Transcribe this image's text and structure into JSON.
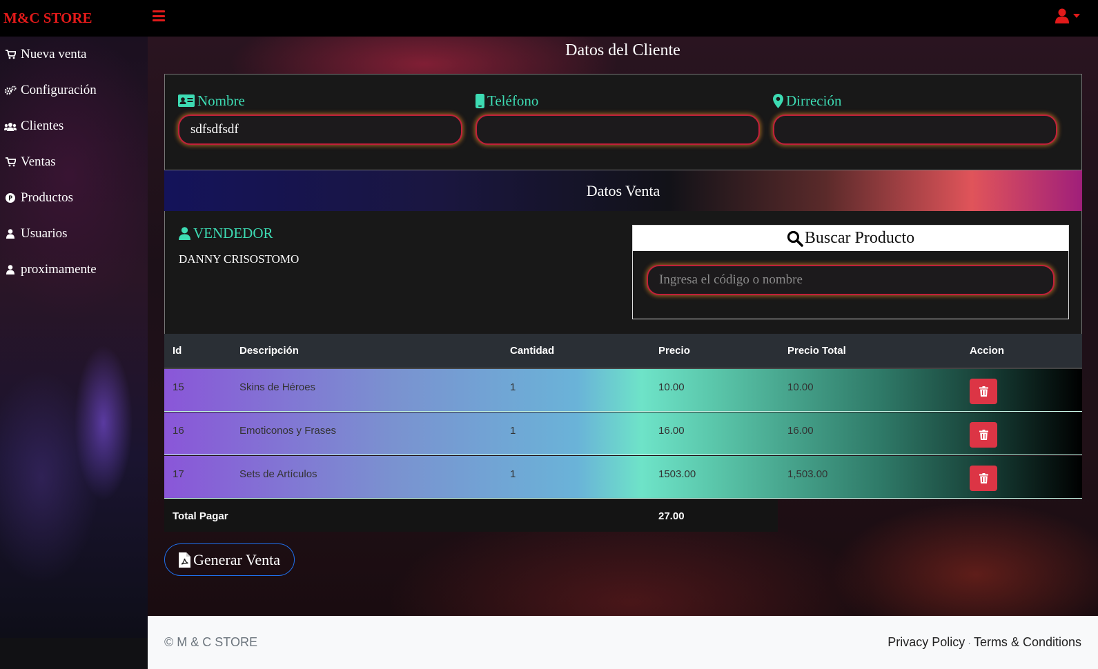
{
  "brand": "M&C STORE",
  "colors": {
    "brand_red": "#e21a1a",
    "accent_teal": "#3ddbb3",
    "danger": "#dc3545",
    "primary_blue": "#1f6feb"
  },
  "sidebar": {
    "items": [
      {
        "label": "Nueva venta",
        "icon": "cart-icon"
      },
      {
        "label": "Configuración",
        "icon": "gears-icon"
      },
      {
        "label": "Clientes",
        "icon": "users-icon"
      },
      {
        "label": "Ventas",
        "icon": "cart-icon"
      },
      {
        "label": "Productos",
        "icon": "product-p-icon"
      },
      {
        "label": "Usuarios",
        "icon": "user-icon"
      },
      {
        "label": "proximamente",
        "icon": "user-icon"
      }
    ]
  },
  "client": {
    "title": "Datos del Cliente",
    "nombre_label": "Nombre",
    "nombre_value": "sdfsdfsdf",
    "telefono_label": "Teléfono",
    "telefono_value": "",
    "direccion_label": "Dirreción",
    "direccion_value": ""
  },
  "venta": {
    "title": "Datos Venta",
    "vendedor_label": "VENDEDOR",
    "vendedor_name": "DANNY CRISOSTOMO",
    "buscar_title": "Buscar Producto",
    "buscar_placeholder": "Ingresa el código o nombre"
  },
  "table": {
    "headers": {
      "id": "Id",
      "desc": "Descripción",
      "cant": "Cantidad",
      "precio": "Precio",
      "total": "Precio Total",
      "accion": "Accion"
    },
    "rows": [
      {
        "id": "15",
        "desc": "Skins de Héroes",
        "cant": "1",
        "precio": "10.00",
        "total": "10.00"
      },
      {
        "id": "16",
        "desc": "Emoticonos y Frases",
        "cant": "1",
        "precio": "16.00",
        "total": "16.00"
      },
      {
        "id": "17",
        "desc": "Sets de Artículos",
        "cant": "1",
        "precio": "1503.00",
        "total": "1,503.00"
      }
    ],
    "total_label": "Total Pagar",
    "total_value": "27.00"
  },
  "generate_button": "Generar Venta",
  "footer": {
    "copyright": "© M & C STORE",
    "privacy": "Privacy Policy",
    "separator": "·",
    "terms": "Terms & Conditions"
  }
}
